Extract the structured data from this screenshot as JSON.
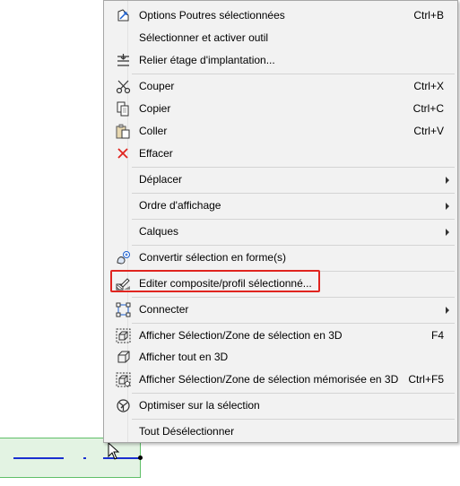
{
  "menu": {
    "items": [
      {
        "label": "Options Poutres sélectionnées",
        "shortcut": "Ctrl+B",
        "icon": "beam-settings-icon"
      },
      {
        "label": "Sélectionner et activer outil",
        "shortcut": "",
        "icon": ""
      },
      {
        "label": "Relier étage d'implantation...",
        "shortcut": "",
        "icon": "link-story-icon"
      },
      {
        "label": "Couper",
        "shortcut": "Ctrl+X",
        "icon": "scissors-icon"
      },
      {
        "label": "Copier",
        "shortcut": "Ctrl+C",
        "icon": "copy-icon"
      },
      {
        "label": "Coller",
        "shortcut": "Ctrl+V",
        "icon": "paste-icon"
      },
      {
        "label": "Effacer",
        "shortcut": "",
        "icon": "delete-x-icon"
      },
      {
        "label": "Déplacer",
        "shortcut": "",
        "icon": "",
        "submenu": true
      },
      {
        "label": "Ordre d'affichage",
        "shortcut": "",
        "icon": "",
        "submenu": true
      },
      {
        "label": "Calques",
        "shortcut": "",
        "icon": "",
        "submenu": true
      },
      {
        "label": "Convertir sélection en forme(s)",
        "shortcut": "",
        "icon": "convert-shape-icon"
      },
      {
        "label": "Editer composite/profil sélectionné...",
        "shortcut": "",
        "icon": "edit-composite-icon"
      },
      {
        "label": "Connecter",
        "shortcut": "",
        "icon": "connect-icon",
        "submenu": true
      },
      {
        "label": "Afficher Sélection/Zone de sélection en 3D",
        "shortcut": "F4",
        "icon": "show-selection-3d-icon"
      },
      {
        "label": "Afficher tout en 3D",
        "shortcut": "",
        "icon": "show-all-3d-icon"
      },
      {
        "label": "Afficher Sélection/Zone de sélection mémorisée en 3D",
        "shortcut": "Ctrl+F5",
        "icon": "show-stored-selection-3d-icon"
      },
      {
        "label": "Optimiser sur la sélection",
        "shortcut": "",
        "icon": "zoom-to-selection-icon"
      },
      {
        "label": "Tout Désélectionner",
        "shortcut": "",
        "icon": ""
      }
    ]
  },
  "colors": {
    "highlight_border": "#e0241f",
    "menu_bg": "#f2f2f2",
    "selection_fill": "#e3f3e3",
    "selection_border": "#5fbf68",
    "beam_line": "#1a2fd0"
  }
}
